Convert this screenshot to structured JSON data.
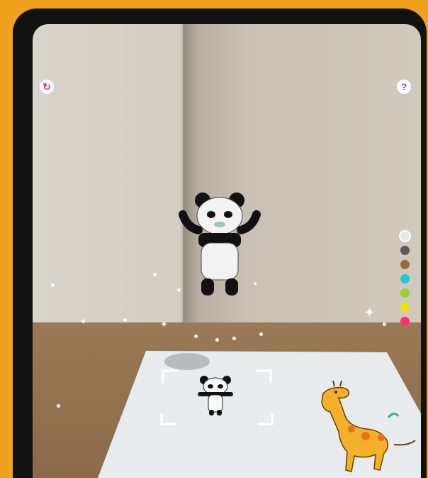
{
  "app": {
    "reset_icon": "refresh-icon",
    "help_icon": "question-icon",
    "help_glyph": "?",
    "reset_glyph": "↻"
  },
  "palette": {
    "colors": [
      "#e9e9e9",
      "#5a5a5a",
      "#9b6b34",
      "#1fc8d9",
      "#9bd12b",
      "#f2e300",
      "#ff2f7a"
    ],
    "selected_index": 0
  }
}
